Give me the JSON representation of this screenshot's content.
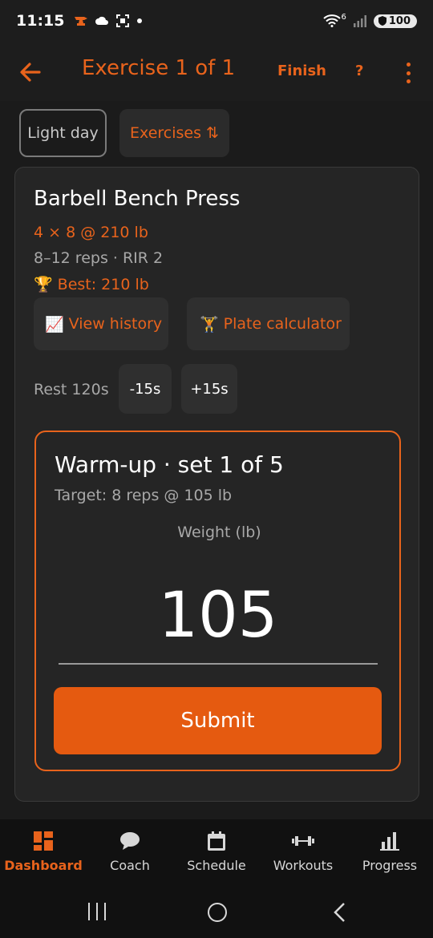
{
  "status": {
    "time": "11:15",
    "battery": "100",
    "network_superscript": "6"
  },
  "header": {
    "title": "Exercise 1 of 1",
    "finish_label": "Finish",
    "help_label": "?"
  },
  "chips": {
    "light_day": "Light day",
    "exercises": "Exercises ⇅"
  },
  "exercise": {
    "name": "Barbell Bench Press",
    "prescription": "4 × 8 @ 210 lb",
    "range": "8–12 reps · RIR 2",
    "best_icon": "🏆",
    "best": "Best: 210 lb",
    "view_history_icon": "📈",
    "view_history": "View history",
    "plate_calc_icon": "🏋",
    "plate_calc": "Plate calculator"
  },
  "rest": {
    "label": "Rest 120s",
    "minus": "-15s",
    "plus": "+15s"
  },
  "set": {
    "title": "Warm-up · set 1 of 5",
    "target": "Target: 8 reps @ 105 lb",
    "weight_label": "Weight (lb)",
    "weight_value": "105",
    "submit": "Submit"
  },
  "nav": {
    "items": [
      {
        "label": "Dashboard",
        "icon": "dashboard-icon",
        "active": true
      },
      {
        "label": "Coach",
        "icon": "chat-icon",
        "active": false
      },
      {
        "label": "Schedule",
        "icon": "calendar-icon",
        "active": false
      },
      {
        "label": "Workouts",
        "icon": "dumbbell-icon",
        "active": false
      },
      {
        "label": "Progress",
        "icon": "bar-chart-icon",
        "active": false
      }
    ]
  },
  "colors": {
    "accent": "#e8631c",
    "submit": "#e55a10",
    "background": "#1b1b1b",
    "card": "#252525"
  }
}
